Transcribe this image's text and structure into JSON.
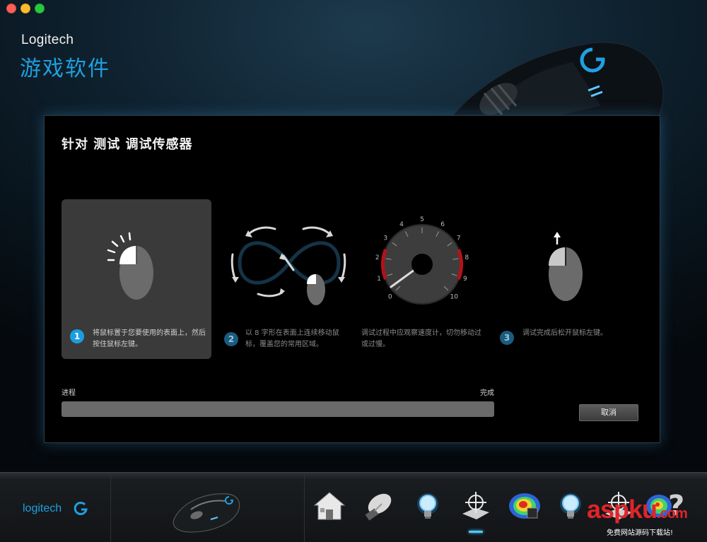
{
  "window": {
    "brand": "Logitech",
    "app_title": "游戏软件"
  },
  "dialog": {
    "title": "针对 测试 调试传感器",
    "steps": [
      {
        "number": "1",
        "text": "将鼠标置于您要使用的表面上，然后按住鼠标左键。",
        "active": true
      },
      {
        "number": "2",
        "text": "以 8 字形在表面上连续移动鼠标，覆盖您的常用区域。",
        "active": false
      },
      {
        "number": "",
        "text": "调试过程中应观察速度计，切勿移动过或过慢。",
        "active": false
      },
      {
        "number": "3",
        "text": "调试完成后松开鼠标左键。",
        "active": false
      }
    ],
    "speedometer": {
      "ticks": [
        "0",
        "1",
        "2",
        "3",
        "4",
        "5",
        "6",
        "7",
        "8",
        "9",
        "10"
      ]
    },
    "progress": {
      "label": "进程",
      "done_label": "完成",
      "value": 0
    },
    "cancel_label": "取消"
  },
  "footer": {
    "logo_text": "logitech",
    "icons": [
      "home-icon",
      "mouse-settings-icon",
      "lighting-icon",
      "sensor-crosshair-icon",
      "heatmap-icon",
      "lighting-icon",
      "sensor-crosshair-icon",
      "heatmap-icon"
    ],
    "help": "?"
  },
  "watermark": {
    "main": "aspku",
    "suffix": ".com",
    "sub": "免费网站源码下载站!"
  },
  "colors": {
    "accent": "#1fa0e0",
    "active_step": "#1a9ee0",
    "gauge_red": "#b3121a"
  }
}
